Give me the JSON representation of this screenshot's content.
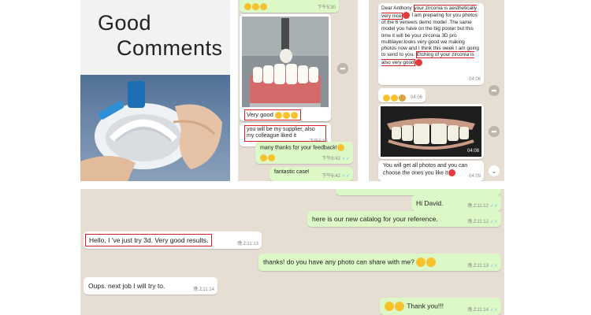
{
  "header": {
    "title_line1": "Good",
    "title_line2": "Comments"
  },
  "chat_middle": {
    "top_time": "下午5:30",
    "msg_very_good": "Very good",
    "msg_supplier": "you will be my supplier, also my colleague liked it",
    "msg_supplier_time": "下午5:35",
    "msg_thanks_feedback": "many thanks for your feedback!",
    "msg_thanks_time": "下午6:42",
    "msg_fantastic": "fantastic case!",
    "msg_fantastic_time": "下午6:42"
  },
  "chat_right": {
    "msg_letter_greeting": "Dear Anthony",
    "msg_letter_hl1": "your zirconia is aesthetically very nice",
    "msg_letter_body": "I am preparing for you photos of the 6 veneers demo model .The same model you have on the big poster but this time it will be your zirconia 3D pro multilayer.looks very good we making photos now and I think this week I am going to send to you.",
    "msg_letter_hl2": "Etching of your zirconia is also very good",
    "msg_letter_time": "04:06",
    "msg_emoji_time": "04:06",
    "photo_time": "04:08",
    "msg_photos": "You will get all photos and you can choose the ones you like it",
    "msg_photos_time": "04:09"
  },
  "chat_bottom": {
    "msg_hi": "Hi David.",
    "msg_hi_time": "晚上11:12",
    "msg_catalog": "here is our new catalog for your reference.",
    "msg_catalog_time": "晚上11:12",
    "msg_tried": "Hello, I 've just try 3d. Very good results.",
    "msg_tried_time": "晚上11:13",
    "msg_photo_share": "thanks! do you have any photo can share with me?",
    "msg_photo_share_time": "晚上11:13",
    "msg_next_job": "Oups. next job I will try to.",
    "msg_next_job_time": "晚上11:14",
    "msg_thank_you": "Thank you!!!",
    "msg_thank_you_time": "晚上11:14"
  },
  "colors": {
    "incoming_bubble": "#ffffff",
    "outgoing_bubble": "#dcf8c6",
    "chat_background": "#e6ddd3",
    "highlight_box": "#d42020",
    "read_ticks": "#4fc3f7"
  }
}
